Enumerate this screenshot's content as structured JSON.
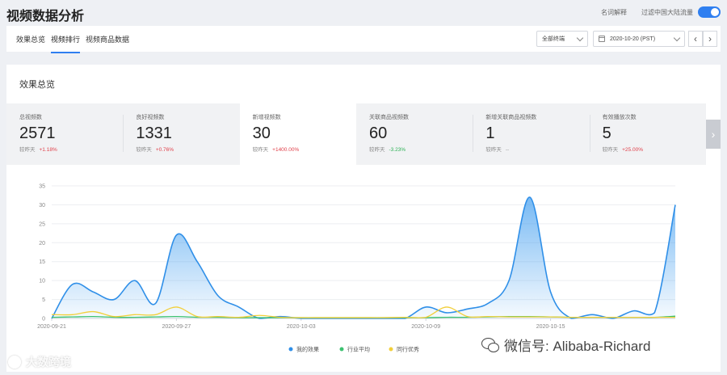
{
  "header": {
    "title": "视频数据分析",
    "glossary_link": "名词解释",
    "filter_label": "过滤中国大陆流量"
  },
  "tabs": [
    {
      "label": "效果总览"
    },
    {
      "label": "视频排行"
    },
    {
      "label": "视频商品数据"
    }
  ],
  "controls": {
    "category_select": "全部终端",
    "date_select": "2020-10-20 (PST)",
    "prev_label": "‹",
    "next_label": "›"
  },
  "overview": {
    "title": "效果总览",
    "compare_label": "较昨天",
    "kpis": [
      {
        "label": "总视频数",
        "value": "2571",
        "change": "+1.18%",
        "trend": "pos"
      },
      {
        "label": "良好视频数",
        "value": "1331",
        "change": "+0.76%",
        "trend": "pos"
      },
      {
        "label": "新增视频数",
        "value": "30",
        "change": "+1400.00%",
        "trend": "pos"
      },
      {
        "label": "关联商品视频数",
        "value": "60",
        "change": "-3.23%",
        "trend": "neg"
      },
      {
        "label": "新增关联商品视频数",
        "value": "1",
        "change": "--",
        "trend": "flat"
      },
      {
        "label": "有效播放次数",
        "value": "5",
        "change": "+25.00%",
        "trend": "pos"
      }
    ],
    "next_button": "›"
  },
  "chart_data": {
    "type": "area",
    "ylim": [
      0,
      35
    ],
    "y_ticks": [
      0,
      5,
      10,
      15,
      20,
      25,
      30,
      35
    ],
    "x_tick_labels": [
      "2020-09-21",
      "2020-09-27",
      "2020-10-03",
      "2020-10-09",
      "2020-10-15"
    ],
    "series": [
      {
        "name": "我的效果",
        "color": "#2f8fe8",
        "points": [
          [
            0,
            0
          ],
          [
            1,
            9
          ],
          [
            2,
            7
          ],
          [
            3,
            5
          ],
          [
            4,
            10
          ],
          [
            5,
            4
          ],
          [
            6,
            22
          ],
          [
            7,
            15
          ],
          [
            8,
            6
          ],
          [
            9,
            3
          ],
          [
            10,
            0
          ],
          [
            11,
            0.5
          ],
          [
            12,
            0
          ],
          [
            13,
            0
          ],
          [
            14,
            0
          ],
          [
            15,
            0
          ],
          [
            16,
            0
          ],
          [
            17,
            0
          ],
          [
            18,
            3
          ],
          [
            19,
            1.5
          ],
          [
            20,
            2.5
          ],
          [
            21,
            4
          ],
          [
            22,
            10
          ],
          [
            23,
            32
          ],
          [
            24,
            7
          ],
          [
            25,
            0
          ],
          [
            26,
            1
          ],
          [
            27,
            0
          ],
          [
            28,
            2
          ],
          [
            29,
            1.5
          ],
          [
            30,
            30
          ]
        ]
      },
      {
        "name": "行业平均",
        "color": "#3cc170",
        "points": [
          [
            0,
            0.3
          ],
          [
            1,
            0.4
          ],
          [
            2,
            0.5
          ],
          [
            3,
            0.3
          ],
          [
            4,
            0.3
          ],
          [
            5,
            0.4
          ],
          [
            6,
            0.5
          ],
          [
            7,
            0.3
          ],
          [
            8,
            0.3
          ],
          [
            9,
            0.2
          ],
          [
            10,
            0.2
          ],
          [
            11,
            0.2
          ],
          [
            12,
            0.2
          ],
          [
            13,
            0.2
          ],
          [
            14,
            0.2
          ],
          [
            15,
            0.2
          ],
          [
            16,
            0.2
          ],
          [
            17,
            0.2
          ],
          [
            18,
            0.2
          ],
          [
            19,
            0.3
          ],
          [
            20,
            0.3
          ],
          [
            21,
            0.4
          ],
          [
            22,
            0.5
          ],
          [
            23,
            0.5
          ],
          [
            24,
            0.4
          ],
          [
            25,
            0.3
          ],
          [
            26,
            0.3
          ],
          [
            27,
            0.3
          ],
          [
            28,
            0.3
          ],
          [
            29,
            0.3
          ],
          [
            30,
            0.6
          ]
        ]
      },
      {
        "name": "同行优秀",
        "color": "#f2cf3a",
        "points": [
          [
            0,
            1
          ],
          [
            1,
            1
          ],
          [
            2,
            1.8
          ],
          [
            3,
            0.5
          ],
          [
            4,
            1
          ],
          [
            5,
            1
          ],
          [
            6,
            3
          ],
          [
            7,
            0.5
          ],
          [
            8,
            0.5
          ],
          [
            9,
            0.3
          ],
          [
            10,
            0.8
          ],
          [
            11,
            0.3
          ],
          [
            12,
            0.2
          ],
          [
            13,
            0.2
          ],
          [
            14,
            0.2
          ],
          [
            15,
            0.2
          ],
          [
            16,
            0.2
          ],
          [
            17,
            0.3
          ],
          [
            18,
            0.3
          ],
          [
            19,
            3
          ],
          [
            20,
            0.5
          ],
          [
            21,
            0.5
          ],
          [
            22,
            0.4
          ],
          [
            23,
            0.4
          ],
          [
            24,
            0.4
          ],
          [
            25,
            0.3
          ],
          [
            26,
            0.3
          ],
          [
            27,
            0.3
          ],
          [
            28,
            0.3
          ],
          [
            29,
            0.3
          ],
          [
            30,
            0.3
          ]
        ]
      }
    ],
    "legend_position": "bottom-center"
  },
  "watermarks": {
    "left": "大数跨境",
    "right": "微信号: Alibaba-Richard"
  }
}
